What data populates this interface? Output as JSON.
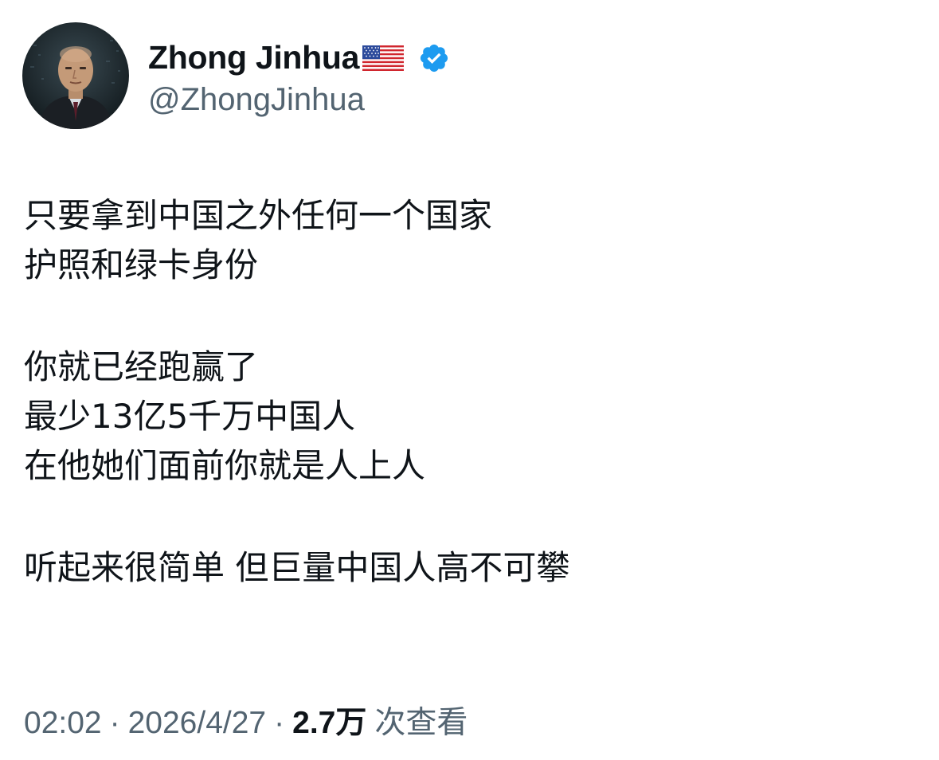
{
  "author": {
    "display_name": "Zhong Jinhua",
    "handle": "@ZhongJinhua",
    "flag_icon": "us-flag-icon",
    "verified_icon": "verified-badge-icon",
    "verified_color": "#1d9bf0"
  },
  "tweet": {
    "paragraphs": [
      [
        "只要拿到中国之外任何一个国家",
        "护照和绿卡身份"
      ],
      [
        "你就已经跑赢了",
        "最少13亿5千万中国人",
        "在他她们面前你就是人上人"
      ],
      [
        "听起来很简单 但巨量中国人高不可攀"
      ]
    ]
  },
  "meta": {
    "time": "02:02",
    "separator": "·",
    "date": "2026/4/27",
    "views_count": "2.7万",
    "views_label": "次查看"
  },
  "colors": {
    "text_primary": "#0f1419",
    "text_secondary": "#536471",
    "background": "#ffffff"
  }
}
